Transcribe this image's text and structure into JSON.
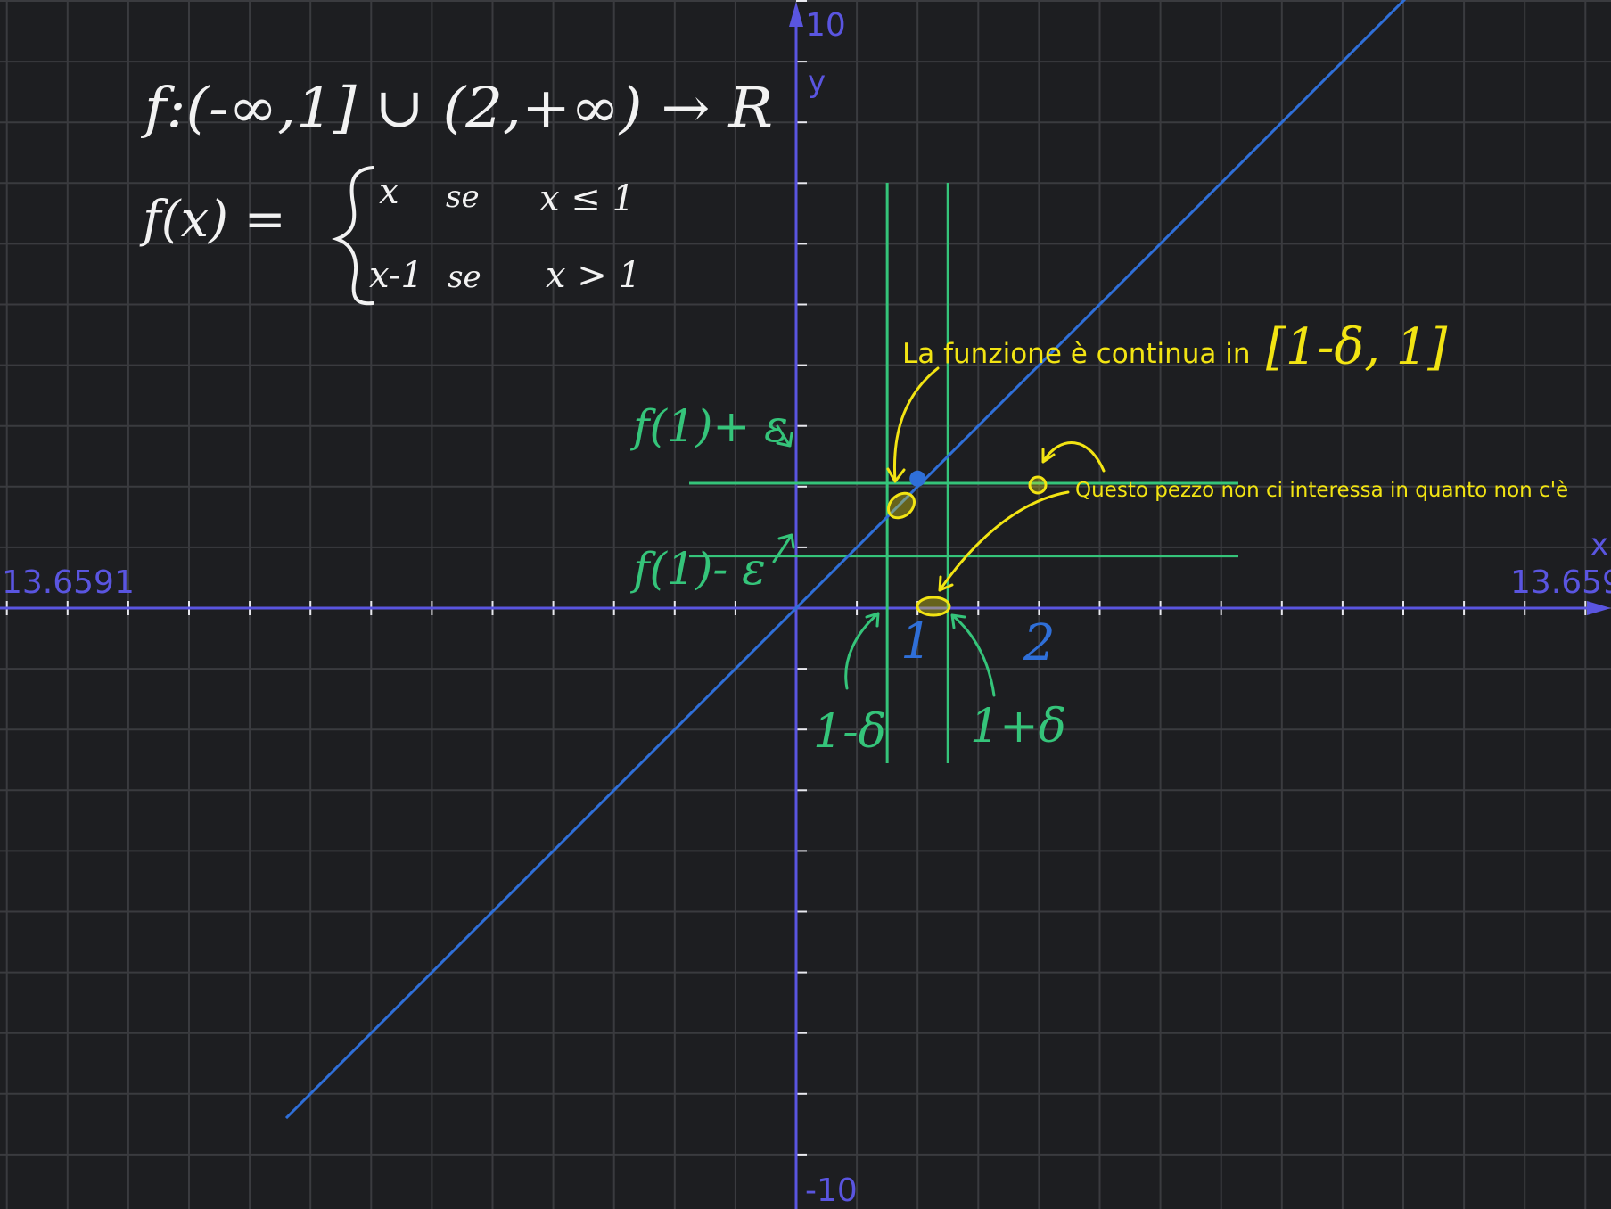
{
  "colors": {
    "background": "#1d1e21",
    "grid": "#3a3b3f",
    "axis": "#5a55e0",
    "function_line": "#2f6fd8",
    "green_annotations": "#35c47a",
    "yellow_annotations": "#f2e413",
    "handwriting_white": "#f2f2f2"
  },
  "chart_data": {
    "type": "line",
    "xlim": [
      -13.6591,
      13.6591
    ],
    "ylim": [
      -10,
      10
    ],
    "grid": true,
    "x_axis_labels": {
      "min": "13.6591",
      "max": "13.659"
    },
    "y_axis_labels": {
      "max": "10",
      "min": "-10"
    },
    "axis_names": {
      "x": "x",
      "y": "y"
    },
    "series": [
      {
        "x": [
          -8.4,
          11.7
        ],
        "y": [
          -8.4,
          11.7
        ]
      }
    ],
    "filled_points": [
      {
        "x": 2,
        "y": 2
      }
    ],
    "green_vertical_lines_x": [
      1.5,
      2.5
    ],
    "green_horizontal_lines_y": [
      2.6,
      1.4
    ]
  },
  "handwritten": {
    "domain_line": "f:(-∞,1] ∪ (2,+∞) → R",
    "fx_label": "f(x) =",
    "case_1_expr": "x",
    "case_1_word": "se",
    "case_1_cond": "x ≤ 1",
    "case_2_expr": "x-1",
    "case_2_word": "se",
    "case_2_cond": "x > 1",
    "f_plus_eps": "f(1)+ ε",
    "f_minus_eps": "f(1)- ε",
    "one_minus_delta": "1-δ",
    "one_plus_delta": "1+δ",
    "tick_one": "1",
    "tick_two": "2",
    "interval": "[1-δ, 1]"
  },
  "annotations": {
    "continuity_text": "La funzione è continua in",
    "piece_note": "Questo pezzo non ci interessa in quanto non c'è"
  }
}
